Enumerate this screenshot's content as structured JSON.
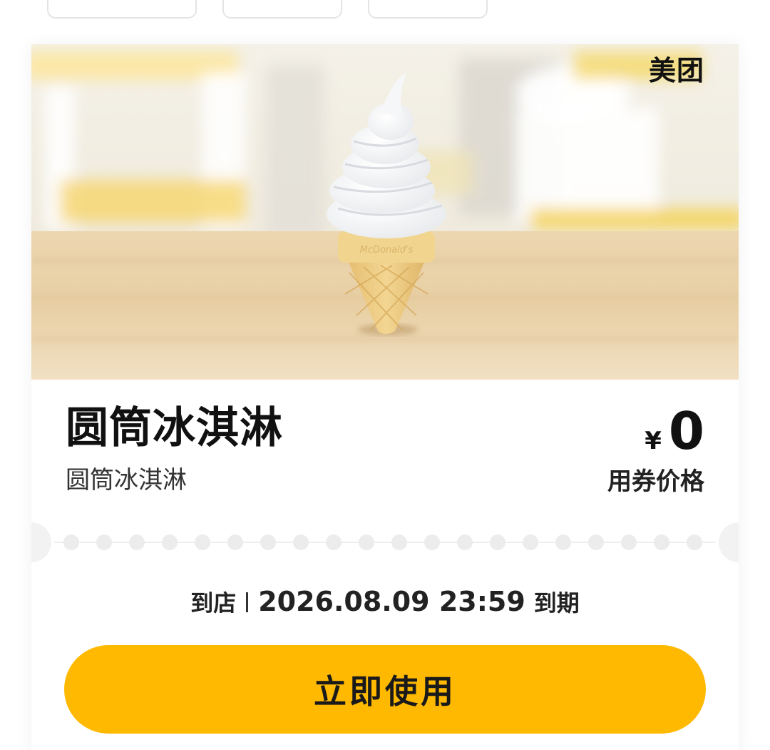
{
  "header": {
    "brand": "美团"
  },
  "coupon": {
    "name": "圆筒冰淇淋",
    "subtitle": "圆筒冰淇淋",
    "currency": "¥",
    "price": "0",
    "price_label": "用券价格"
  },
  "expiry": {
    "prefix": "到店",
    "datetime": "2026.08.09 23:59",
    "suffix": "到期"
  },
  "action": {
    "use_label": "立即使用"
  },
  "colors": {
    "button": "#ffb900",
    "text": "#111111"
  }
}
